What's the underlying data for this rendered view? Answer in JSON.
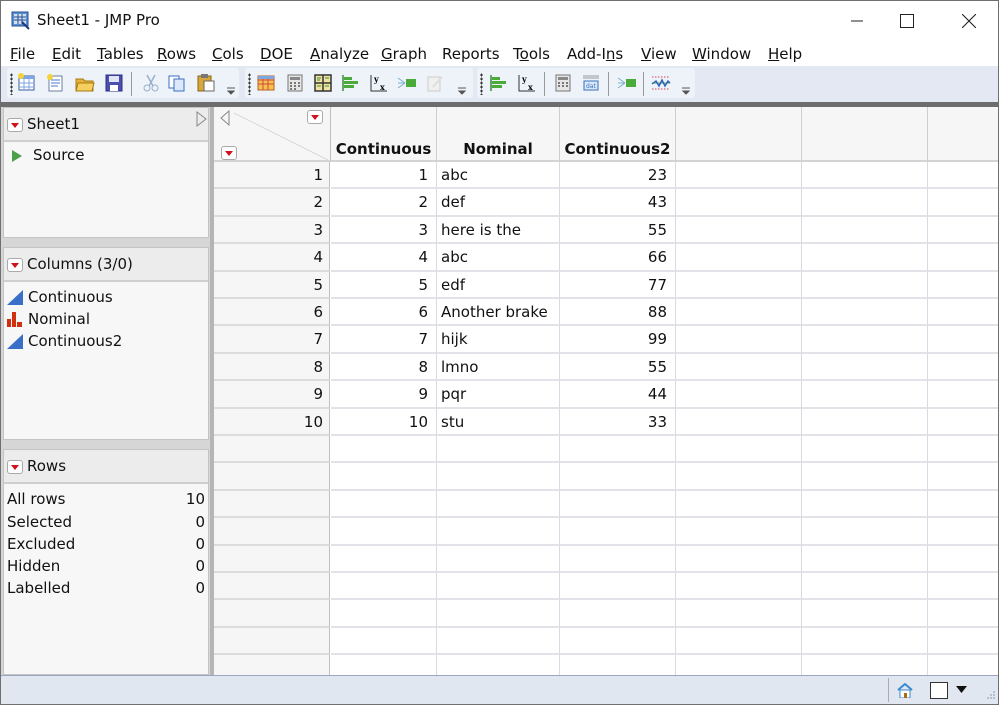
{
  "window": {
    "title": "Sheet1 - JMP Pro",
    "controls": [
      "minimize",
      "maximize",
      "close"
    ]
  },
  "menubar": {
    "items": [
      {
        "label": "File",
        "ul": "F",
        "rest": "ile"
      },
      {
        "label": "Edit",
        "ul": "E",
        "rest": "dit"
      },
      {
        "label": "Tables",
        "ul": "T",
        "rest": "ables"
      },
      {
        "label": "Rows",
        "ul": "R",
        "rest": "ows"
      },
      {
        "label": "Cols",
        "ul": "C",
        "rest": "ols"
      },
      {
        "label": "DOE",
        "ul": "D",
        "rest": "OE"
      },
      {
        "label": "Analyze",
        "ul": "A",
        "rest": "nalyze"
      },
      {
        "label": "Graph",
        "ul": "G",
        "rest": "raph"
      },
      {
        "label": "Reports",
        "ul": "",
        "rest": "Reports"
      },
      {
        "label": "Tools",
        "ul": "o",
        "pre": "T",
        "rest": "ols"
      },
      {
        "label": "Add-Ins",
        "ul": "n",
        "pre": "Add-I",
        "rest": "s"
      },
      {
        "label": "View",
        "ul": "V",
        "rest": "iew"
      },
      {
        "label": "Window",
        "ul": "W",
        "rest": "indow"
      },
      {
        "label": "Help",
        "ul": "H",
        "rest": "elp"
      }
    ]
  },
  "toolbar": {
    "file_tools": [
      "new-data-table",
      "new-script",
      "open",
      "save",
      "cut",
      "copy",
      "paste"
    ],
    "table_tools": [
      "data-grid",
      "tabulate",
      "subset-grid",
      "distribution",
      "fit-y-by-x",
      "fit-model",
      "edit-disabled"
    ],
    "analysis_tools": [
      "distribution",
      "fit-y-by-x",
      "tabulate",
      "data-view",
      "fit-model",
      "control-chart"
    ]
  },
  "left_panel": {
    "table_panel": {
      "title": "Sheet1",
      "items": [
        {
          "label": "Source"
        }
      ]
    },
    "columns_panel": {
      "title": "Columns (3/0)",
      "columns": [
        {
          "name": "Continuous",
          "type": "continuous"
        },
        {
          "name": "Nominal",
          "type": "nominal"
        },
        {
          "name": "Continuous2",
          "type": "continuous"
        }
      ]
    },
    "rows_panel": {
      "title": "Rows",
      "stats": [
        {
          "label": "All rows",
          "value": "10"
        },
        {
          "label": "Selected",
          "value": "0"
        },
        {
          "label": "Excluded",
          "value": "0"
        },
        {
          "label": "Hidden",
          "value": "0"
        },
        {
          "label": "Labelled",
          "value": "0"
        }
      ]
    }
  },
  "grid": {
    "columns": [
      "Continuous",
      "Nominal",
      "Continuous2"
    ],
    "rows": [
      {
        "n": "1",
        "c1": "1",
        "c2": "abc",
        "c3": "23"
      },
      {
        "n": "2",
        "c1": "2",
        "c2": "def",
        "c3": "43"
      },
      {
        "n": "3",
        "c1": "3",
        "c2": "here is the",
        "c3": "55"
      },
      {
        "n": "4",
        "c1": "4",
        "c2": "abc",
        "c3": "66"
      },
      {
        "n": "5",
        "c1": "5",
        "c2": "edf",
        "c3": "77"
      },
      {
        "n": "6",
        "c1": "6",
        "c2": "Another brake",
        "c3": "88"
      },
      {
        "n": "7",
        "c1": "7",
        "c2": "hijk",
        "c3": "99"
      },
      {
        "n": "8",
        "c1": "8",
        "c2": "lmno",
        "c3": "55"
      },
      {
        "n": "9",
        "c1": "9",
        "c2": "pqr",
        "c3": "44"
      },
      {
        "n": "10",
        "c1": "10",
        "c2": "stu",
        "c3": "33"
      }
    ]
  },
  "statusbar": {
    "icons": [
      "home-icon",
      "window-select-icon",
      "dropdown-arrow-icon"
    ]
  },
  "colors": {
    "red_triangle": "#d0121b",
    "continuous_icon": "#3a6fc8",
    "nominal_icon": "#d03010",
    "source_triangle": "#4ca04c"
  }
}
